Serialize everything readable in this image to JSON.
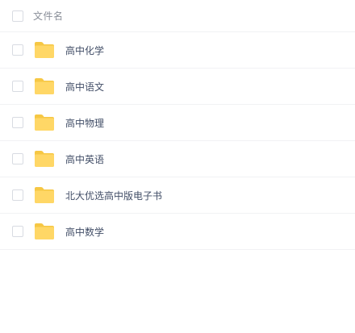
{
  "header": {
    "select_all_label": "",
    "column_label": "文件名"
  },
  "files": [
    {
      "name": "高中化学",
      "type": "folder-icon"
    },
    {
      "name": "高中语文",
      "type": "folder-icon"
    },
    {
      "name": "高中物理",
      "type": "folder-icon"
    },
    {
      "name": "高中英语",
      "type": "folder-icon"
    },
    {
      "name": "北大优选高中版电子书",
      "type": "folder-icon"
    },
    {
      "name": "高中数学",
      "type": "folder-icon"
    }
  ],
  "colors": {
    "folder_main": "#ffd766",
    "folder_tab": "#f6c744",
    "text": "#424e67",
    "muted": "#8a8f99",
    "divider": "#f1f2f4"
  }
}
